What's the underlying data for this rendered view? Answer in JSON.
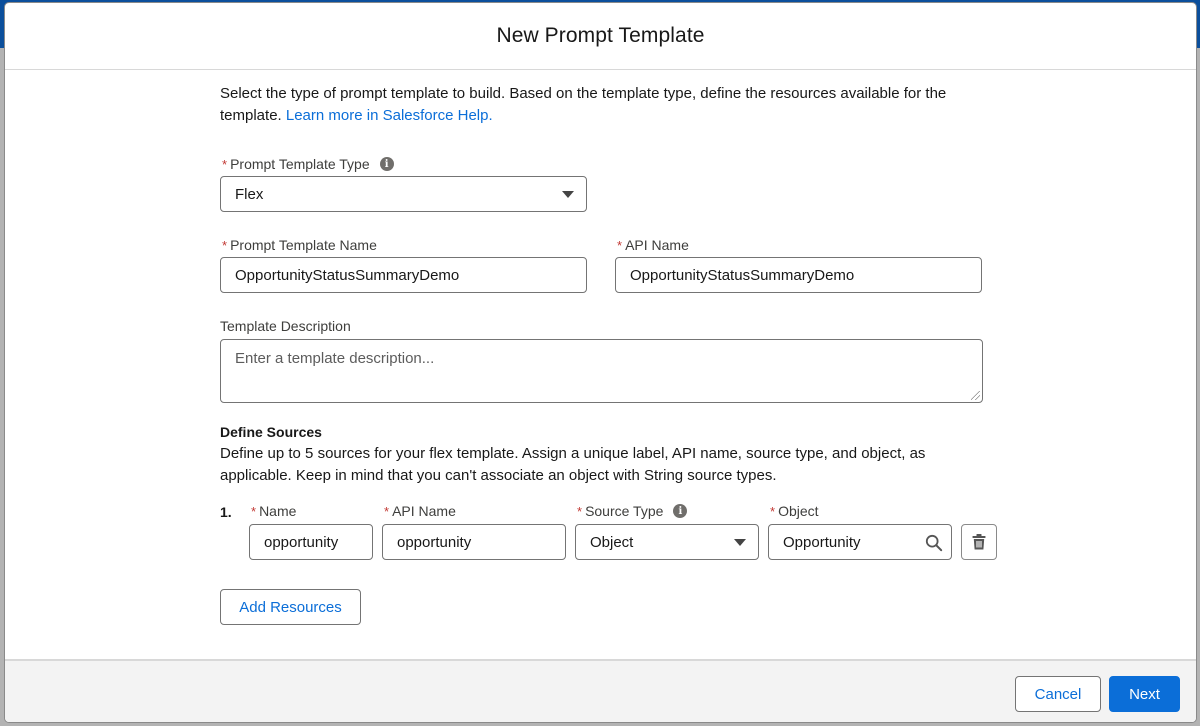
{
  "modal": {
    "title": "New Prompt Template",
    "intro_text": "Select the type of prompt template to build. Based on the template type, define the resources available for the template.",
    "intro_link": "Learn more in Salesforce Help."
  },
  "form": {
    "template_type": {
      "label": "Prompt Template Type",
      "value": "Flex"
    },
    "template_name": {
      "label": "Prompt Template Name",
      "value": "OpportunityStatusSummaryDemo"
    },
    "api_name": {
      "label": "API Name",
      "value": "OpportunityStatusSummaryDemo"
    },
    "description": {
      "label": "Template Description",
      "placeholder": "Enter a template description..."
    }
  },
  "sources": {
    "title": "Define Sources",
    "description": "Define up to 5 sources for your flex template. Assign a unique label, API name, source type, and object, as applicable. Keep in mind that you can't associate an object with String source types.",
    "rows": [
      {
        "number": "1.",
        "name_label": "Name",
        "name_value": "opportunity",
        "api_label": "API Name",
        "api_value": "opportunity",
        "type_label": "Source Type",
        "type_value": "Object",
        "object_label": "Object",
        "object_value": "Opportunity"
      }
    ],
    "add_button": "Add Resources"
  },
  "footer": {
    "cancel": "Cancel",
    "next": "Next"
  },
  "icons": [
    "info-icon",
    "chevron-down-icon",
    "search-icon",
    "trash-icon"
  ],
  "colors": {
    "brand": "#0b6ed8",
    "required": "#c23934"
  }
}
